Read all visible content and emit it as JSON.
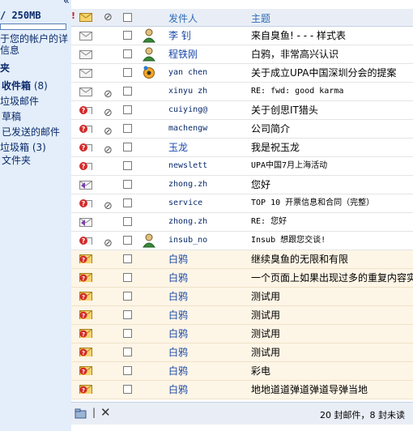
{
  "sidebar": {
    "quota_text": "/ 250MB",
    "account_info_line1": "于您的帐户的详",
    "account_info_line2": "信息",
    "folders_label": "夹",
    "inbox_label": "收件箱",
    "inbox_count": "(8)",
    "junk_label": "垃圾邮件",
    "drafts_label": "草稿",
    "sent_label": "已发送的邮件",
    "trash_label": "垃圾箱",
    "trash_count": "(3)",
    "folder_label": "文件夹"
  },
  "header": {
    "sender": "发件人",
    "subject": "主题"
  },
  "rows": [
    {
      "icon": "read-envelope-icon",
      "clip": false,
      "avatar": "contact-icon",
      "sender": "李 钊",
      "subject": "来自臭鱼! - - - 样式表",
      "mono": false,
      "sys": false
    },
    {
      "icon": "read-envelope-icon",
      "clip": false,
      "avatar": "contact-icon",
      "sender": "程铁刚",
      "subject": "白鸦，非常高兴认识",
      "mono": false,
      "sys": false
    },
    {
      "icon": "read-envelope-icon",
      "clip": false,
      "avatar": "online-contact-icon",
      "sender": "yan chen",
      "subject": "关于成立UPA中国深圳分会的提案",
      "mono": true,
      "sys": false
    },
    {
      "icon": "read-envelope-icon",
      "clip": true,
      "avatar": "",
      "sender": "xinyu zh",
      "subject": "RE: fwd: good karma",
      "mono": true,
      "sys": false
    },
    {
      "icon": "unknown-message-icon",
      "clip": true,
      "avatar": "",
      "sender": "cuiying@",
      "subject": "关于创思IT猎头",
      "mono": true,
      "sys": false
    },
    {
      "icon": "unknown-message-icon",
      "clip": true,
      "avatar": "",
      "sender": "machengw",
      "subject": "公司简介",
      "mono": true,
      "sys": false
    },
    {
      "icon": "unknown-message-icon",
      "clip": true,
      "avatar": "",
      "sender": "玉龙",
      "subject": "我是祝玉龙",
      "mono": false,
      "sys": false
    },
    {
      "icon": "unknown-message-icon",
      "clip": false,
      "avatar": "",
      "sender": "newslett",
      "subject": "UPA中国7月上海活动",
      "mono": true,
      "sys": false
    },
    {
      "icon": "reply-envelope-icon",
      "clip": false,
      "avatar": "",
      "sender": "zhong.zh",
      "subject": "您好",
      "mono": true,
      "sys": false
    },
    {
      "icon": "unknown-message-icon",
      "clip": true,
      "avatar": "",
      "sender": "service",
      "subject": "TOP 10 开票信息和合同（完整）",
      "mono": true,
      "sys": false
    },
    {
      "icon": "reply-envelope-icon",
      "clip": false,
      "avatar": "",
      "sender": "zhong.zh",
      "subject": "RE: 您好",
      "mono": true,
      "sys": false
    },
    {
      "icon": "unknown-message-icon",
      "clip": true,
      "avatar": "contact-icon",
      "sender": "insub_no",
      "subject": "Insub 想跟您交谈!",
      "mono": true,
      "sys": false
    },
    {
      "icon": "system-message-icon",
      "clip": false,
      "avatar": "",
      "sender": "白鸦",
      "subject": "继续臭鱼的无限和有限",
      "mono": false,
      "sys": true
    },
    {
      "icon": "system-message-icon",
      "clip": false,
      "avatar": "",
      "sender": "白鸦",
      "subject": "一个页面上如果出现过多的重复内容实",
      "mono": false,
      "sys": true
    },
    {
      "icon": "system-message-icon",
      "clip": false,
      "avatar": "",
      "sender": "白鸦",
      "subject": "测试用",
      "mono": false,
      "sys": true
    },
    {
      "icon": "system-message-icon",
      "clip": false,
      "avatar": "",
      "sender": "白鸦",
      "subject": "测试用",
      "mono": false,
      "sys": true
    },
    {
      "icon": "system-message-icon",
      "clip": false,
      "avatar": "",
      "sender": "白鸦",
      "subject": "测试用",
      "mono": false,
      "sys": true
    },
    {
      "icon": "system-message-icon",
      "clip": false,
      "avatar": "",
      "sender": "白鸦",
      "subject": "测试用",
      "mono": false,
      "sys": true
    },
    {
      "icon": "system-message-icon",
      "clip": false,
      "avatar": "",
      "sender": "白鸦",
      "subject": "彩电",
      "mono": false,
      "sys": true
    },
    {
      "icon": "system-message-icon",
      "clip": false,
      "avatar": "",
      "sender": "白鸦",
      "subject": "地地道道弹道弹道导弹当地",
      "mono": false,
      "sys": true
    }
  ],
  "footer": {
    "summary": "20 封邮件，8 封未读"
  },
  "colors": {
    "sidebar_bg": "#e3eefa",
    "header_text": "#2f6db5",
    "system_row_bg": "#fdf5e6"
  }
}
